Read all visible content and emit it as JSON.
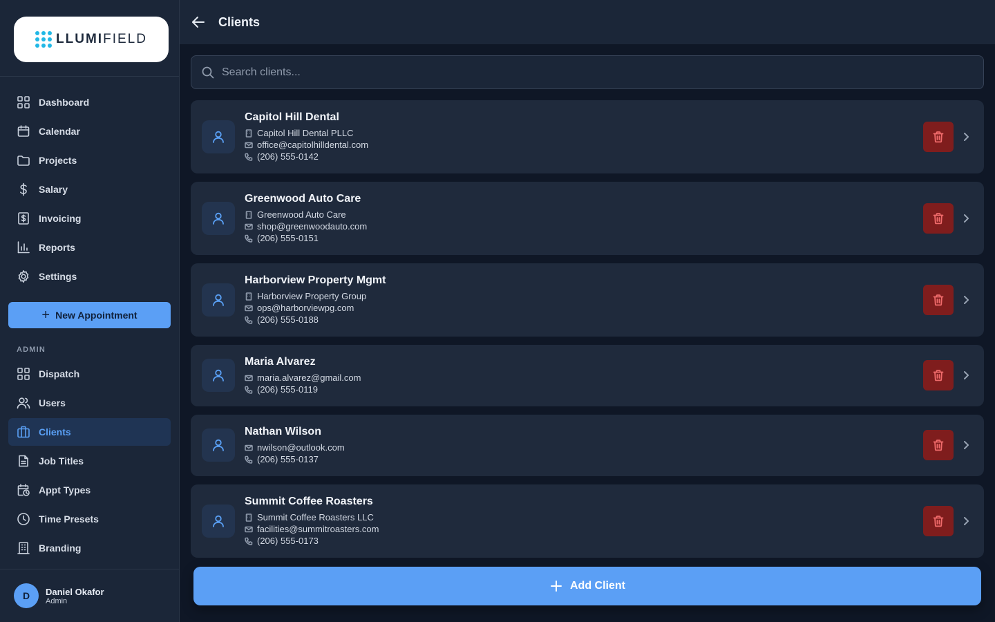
{
  "brand": {
    "logo_bold": "LLUMI",
    "logo_light": "FIELD"
  },
  "colors": {
    "accent": "#5b9ff5",
    "danger": "#7f1d1d",
    "sidebar_bg": "#1b2638",
    "page_bg": "#0f1726",
    "card_bg": "#1f2a3c"
  },
  "sidebar": {
    "items": [
      {
        "label": "Dashboard",
        "icon": "dashboard-icon"
      },
      {
        "label": "Calendar",
        "icon": "calendar-icon"
      },
      {
        "label": "Projects",
        "icon": "folder-icon"
      },
      {
        "label": "Salary",
        "icon": "dollar-icon"
      },
      {
        "label": "Invoicing",
        "icon": "invoice-icon"
      },
      {
        "label": "Reports",
        "icon": "bar-chart-icon"
      },
      {
        "label": "Settings",
        "icon": "gear-icon"
      }
    ],
    "new_appointment_label": "New Appointment",
    "admin_label": "ADMIN",
    "admin_items": [
      {
        "label": "Dispatch",
        "icon": "dispatch-icon"
      },
      {
        "label": "Users",
        "icon": "users-icon"
      },
      {
        "label": "Clients",
        "icon": "briefcase-icon",
        "active": true
      },
      {
        "label": "Job Titles",
        "icon": "document-icon"
      },
      {
        "label": "Appt Types",
        "icon": "calendar-clock-icon"
      },
      {
        "label": "Time Presets",
        "icon": "clock-icon"
      },
      {
        "label": "Branding",
        "icon": "building-icon"
      }
    ]
  },
  "user": {
    "initial": "D",
    "name": "Daniel Okafor",
    "role": "Admin"
  },
  "header": {
    "title": "Clients"
  },
  "search": {
    "placeholder": "Search clients..."
  },
  "clients": [
    {
      "name": "Capitol Hill Dental",
      "company": "Capitol Hill Dental PLLC",
      "email": "office@capitolhilldental.com",
      "phone": "(206) 555-0142"
    },
    {
      "name": "Greenwood Auto Care",
      "company": "Greenwood Auto Care",
      "email": "shop@greenwoodauto.com",
      "phone": "(206) 555-0151"
    },
    {
      "name": "Harborview Property Mgmt",
      "company": "Harborview Property Group",
      "email": "ops@harborviewpg.com",
      "phone": "(206) 555-0188"
    },
    {
      "name": "Maria Alvarez",
      "email": "maria.alvarez@gmail.com",
      "phone": "(206) 555-0119"
    },
    {
      "name": "Nathan Wilson",
      "email": "nwilson@outlook.com",
      "phone": "(206) 555-0137"
    },
    {
      "name": "Summit Coffee Roasters",
      "company": "Summit Coffee Roasters LLC",
      "email": "facilities@summitroasters.com",
      "phone": "(206) 555-0173"
    }
  ],
  "add_client_label": "Add Client"
}
